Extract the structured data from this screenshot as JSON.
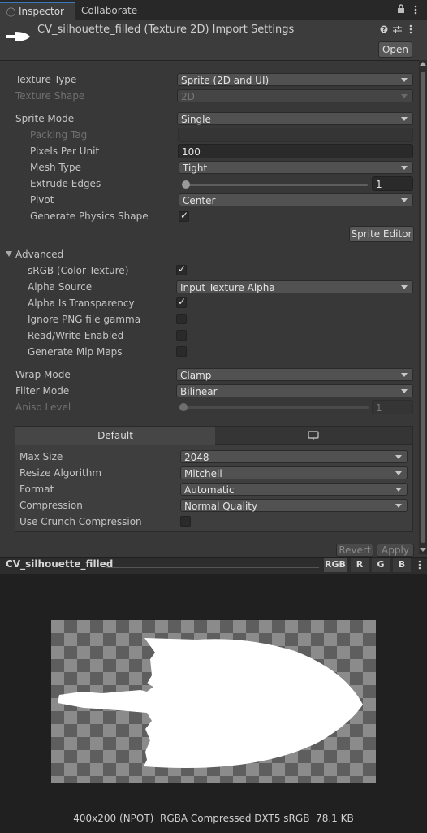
{
  "tabs": {
    "inspector": "Inspector",
    "collaborate": "Collaborate"
  },
  "header": {
    "title": "CV_silhouette_filled (Texture 2D) Import Settings",
    "open_label": "Open"
  },
  "settings": {
    "texture_type": {
      "label": "Texture Type",
      "value": "Sprite (2D and UI)"
    },
    "texture_shape": {
      "label": "Texture Shape",
      "value": "2D"
    },
    "sprite_mode": {
      "label": "Sprite Mode",
      "value": "Single"
    },
    "packing_tag": {
      "label": "Packing Tag",
      "value": ""
    },
    "pixels_per_unit": {
      "label": "Pixels Per Unit",
      "value": "100"
    },
    "mesh_type": {
      "label": "Mesh Type",
      "value": "Tight"
    },
    "extrude_edges": {
      "label": "Extrude Edges",
      "value": "1",
      "fraction": 0.0
    },
    "pivot": {
      "label": "Pivot",
      "value": "Center"
    },
    "generate_physics": {
      "label": "Generate Physics Shape",
      "checked": true
    },
    "sprite_editor_label": "Sprite Editor"
  },
  "advanced": {
    "label": "Advanced",
    "srgb": {
      "label": "sRGB (Color Texture)",
      "checked": true
    },
    "alpha_source": {
      "label": "Alpha Source",
      "value": "Input Texture Alpha"
    },
    "alpha_transparency": {
      "label": "Alpha Is Transparency",
      "checked": true
    },
    "ignore_png_gamma": {
      "label": "Ignore PNG file gamma",
      "checked": false
    },
    "read_write": {
      "label": "Read/Write Enabled",
      "checked": false
    },
    "mip_maps": {
      "label": "Generate Mip Maps",
      "checked": false
    }
  },
  "wrap": {
    "wrap_mode": {
      "label": "Wrap Mode",
      "value": "Clamp"
    },
    "filter_mode": {
      "label": "Filter Mode",
      "value": "Bilinear"
    },
    "aniso_level": {
      "label": "Aniso Level",
      "value": "1",
      "fraction": 0.0
    }
  },
  "platform": {
    "default_tab": "Default",
    "max_size": {
      "label": "Max Size",
      "value": "2048"
    },
    "resize": {
      "label": "Resize Algorithm",
      "value": "Mitchell"
    },
    "format": {
      "label": "Format",
      "value": "Automatic"
    },
    "compression": {
      "label": "Compression",
      "value": "Normal Quality"
    },
    "crunch": {
      "label": "Use Crunch Compression",
      "checked": false
    }
  },
  "footer": {
    "revert": "Revert",
    "apply": "Apply"
  },
  "preview": {
    "name": "CV_silhouette_filled",
    "channels": [
      "RGB",
      "R",
      "G",
      "B"
    ],
    "info": "400x200 (NPOT)  RGBA Compressed DXT5 sRGB  78.1 KB"
  }
}
